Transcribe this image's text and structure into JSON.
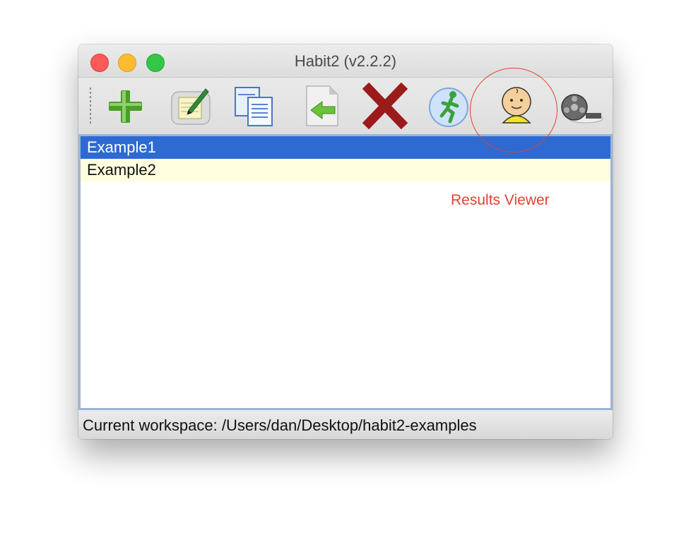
{
  "window": {
    "title": "Habit2 (v2.2.2)"
  },
  "toolbar": {
    "buttons": [
      {
        "icon": "add-icon",
        "tooltip": "New"
      },
      {
        "icon": "edit-icon",
        "tooltip": "Edit"
      },
      {
        "icon": "copy-icon",
        "tooltip": "Copy"
      },
      {
        "icon": "import-icon",
        "tooltip": "Import"
      },
      {
        "icon": "delete-icon",
        "tooltip": "Delete"
      },
      {
        "icon": "run-icon",
        "tooltip": "Run"
      },
      {
        "icon": "baby-icon",
        "tooltip": "Results Viewer"
      },
      {
        "icon": "film-reel-icon",
        "tooltip": "Stimuli"
      }
    ]
  },
  "list": {
    "items": [
      {
        "label": "Example1",
        "selected": true
      },
      {
        "label": "Example2",
        "selected": false
      }
    ]
  },
  "status": {
    "text": "Current workspace: /Users/dan/Desktop/habit2-examples"
  },
  "annotation": {
    "label": "Results Viewer",
    "color": "#e0432c"
  },
  "colors": {
    "selection": "#2d6bd3",
    "alt_row": "#ffffe0",
    "border_accent": "#9cb5d8"
  }
}
